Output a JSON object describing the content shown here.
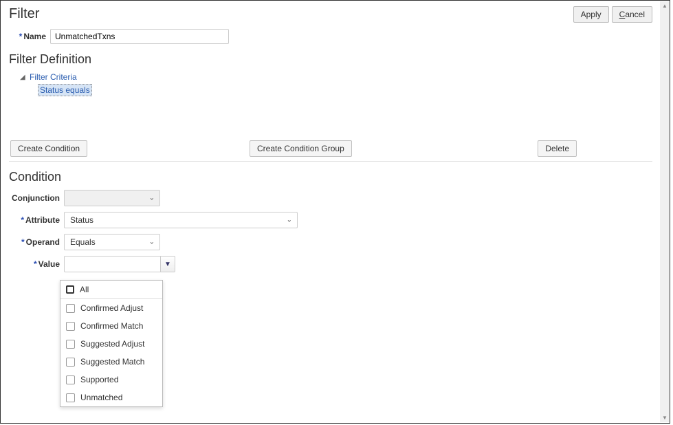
{
  "header": {
    "title": "Filter",
    "apply_label": "Apply",
    "cancel_label": "Cancel"
  },
  "form": {
    "name_label": "Name",
    "name_value": "UnmatchedTxns"
  },
  "definition": {
    "title": "Filter Definition",
    "root": "Filter Criteria",
    "selected_criteria": "Status equals"
  },
  "action_bar": {
    "create_condition": "Create Condition",
    "create_group": "Create Condition Group",
    "delete": "Delete"
  },
  "condition": {
    "title": "Condition",
    "conjunction_label": "Conjunction",
    "conjunction_value": "",
    "attribute_label": "Attribute",
    "attribute_value": "Status",
    "operand_label": "Operand",
    "operand_value": "Equals",
    "value_label": "Value",
    "value_value": ""
  },
  "value_options": [
    "All",
    "Confirmed Adjust",
    "Confirmed Match",
    "Suggested Adjust",
    "Suggested Match",
    "Supported",
    "Unmatched"
  ]
}
